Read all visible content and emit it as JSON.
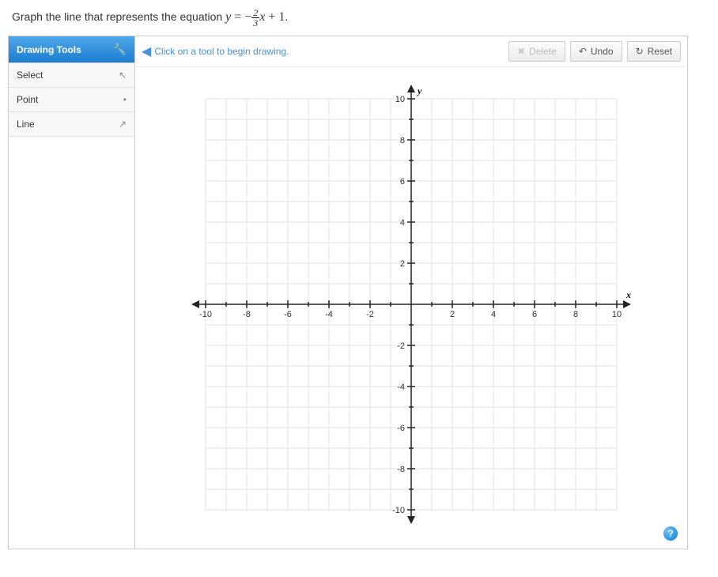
{
  "question": {
    "prefix": "Graph the line that represents the equation ",
    "eq_y": "y",
    "eq_eqsign": " = −",
    "eq_num": "2",
    "eq_den": "3",
    "eq_x": "x",
    "eq_tail": " + 1",
    "period": "."
  },
  "sidebar": {
    "header": "Drawing Tools",
    "items": [
      {
        "label": "Select",
        "icon": "↖"
      },
      {
        "label": "Point",
        "icon": "•"
      },
      {
        "label": "Line",
        "icon": "↗"
      }
    ]
  },
  "toolbar": {
    "hint": "Click on a tool to begin drawing.",
    "delete": "Delete",
    "undo": "Undo",
    "reset": "Reset"
  },
  "help": "?",
  "chart_data": {
    "type": "scatter",
    "title": "",
    "xlabel": "x",
    "ylabel": "y",
    "xlim": [
      -10,
      10
    ],
    "ylim": [
      -10,
      10
    ],
    "x_ticks_labeled": [
      -10,
      -8,
      -6,
      -4,
      -2,
      2,
      4,
      6,
      8,
      10
    ],
    "y_ticks_labeled": [
      -10,
      -8,
      -6,
      -4,
      -2,
      2,
      4,
      6,
      8,
      10
    ],
    "grid_step": 1,
    "series": []
  }
}
